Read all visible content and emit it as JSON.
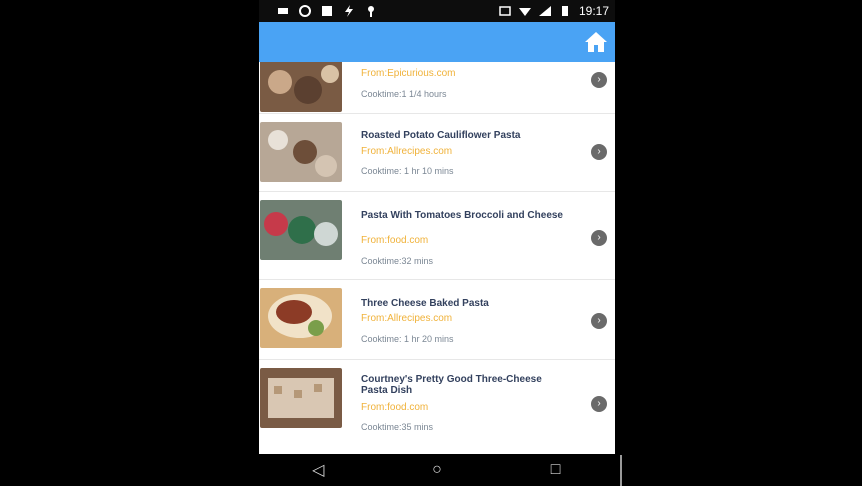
{
  "status_bar": {
    "time": "19:17",
    "left_icons": [
      "battery-icon",
      "circle-icon",
      "square-icon",
      "bolt-icon",
      "location-icon"
    ],
    "right_icons": [
      "sim-icon",
      "wifi-icon",
      "signal-icon",
      "battery-status-icon"
    ]
  },
  "app_bar": {
    "home_icon": "home-icon",
    "accent_color": "#4aa3f4"
  },
  "recipes": [
    {
      "title": "",
      "source": "From:Epicurious.com",
      "cooktime": "Cooktime:1 1/4 hours"
    },
    {
      "title": "Roasted Potato Cauliflower Pasta",
      "source": "From:Allrecipes.com",
      "cooktime": "Cooktime: 1 hr 10 mins"
    },
    {
      "title": "Pasta With Tomatoes Broccoli and Cheese",
      "source": "From:food.com",
      "cooktime": "Cooktime:32 mins"
    },
    {
      "title": "Three Cheese Baked Pasta",
      "source": "From:Allrecipes.com",
      "cooktime": "Cooktime: 1 hr 20 mins"
    },
    {
      "title": "Courtney's Pretty Good Three-Cheese Pasta Dish",
      "source": "From:food.com",
      "cooktime": "Cooktime:35 mins"
    }
  ],
  "nav": {
    "back_icon": "◁",
    "home_icon": "○",
    "recents_icon": "□"
  }
}
